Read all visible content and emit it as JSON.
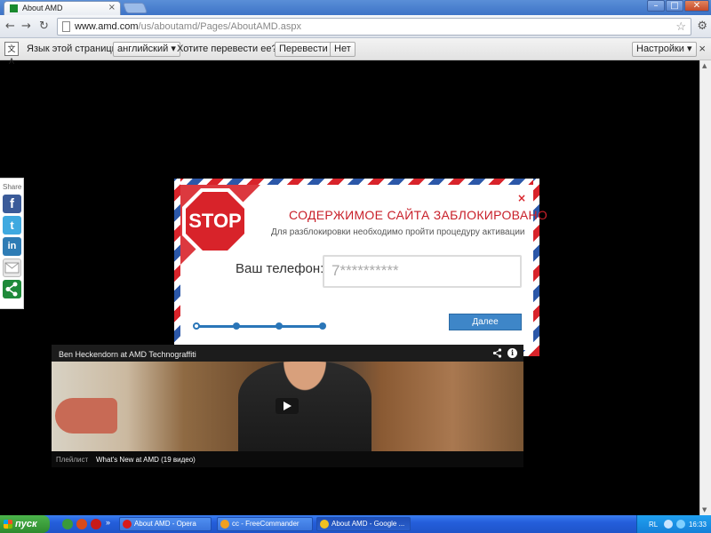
{
  "browser": {
    "tab_title": "About AMD",
    "tab_close": "×",
    "window_buttons": {
      "minimize": "–",
      "maximize": "□",
      "close": "✕"
    },
    "url_host": "www.amd.com",
    "url_path": "/us/aboutamd/Pages/AboutAMD.aspx",
    "nav": {
      "back": "←",
      "forward": "→",
      "reload": "↻"
    },
    "star": "☆",
    "wrench": "⚙"
  },
  "translate_bar": {
    "icon": "文A",
    "prompt": "Язык этой страницы:",
    "language": "английский ▾",
    "question": "Хотите перевести ее?",
    "translate_button": "Перевести",
    "no_button": "Нет",
    "settings_button": "Настройки ▾",
    "close": "×"
  },
  "share_panel": {
    "label": "Share",
    "facebook": "f",
    "twitter": "t",
    "linkedin": "in",
    "email": "",
    "share": "≪"
  },
  "popup": {
    "stop_sign": "STOP",
    "title": "СОДЕРЖИМОЕ САЙТА ЗАБЛОКИРОВАНО",
    "subtitle": "Для разблокировки необходимо пройти процедуру активации",
    "phone_label": "Ваш телефон:",
    "phone_value": "7**********",
    "next_button": "Далее",
    "close": "×",
    "progress": {
      "steps": 4,
      "current": 1
    }
  },
  "video": {
    "title": "Ben Heckendorn at AMD Technograffiti",
    "share_icon": "⋖",
    "info_icon": "i",
    "playlist_label": "Плейлист",
    "playlist_title": "What's New at AMD (19 видео)"
  },
  "taskbar": {
    "start": "пуск",
    "windows": [
      {
        "label": "About AMD - Opera",
        "color": "#d81b1b"
      },
      {
        "label": "cc - FreeCommander",
        "color": "#f0a020"
      },
      {
        "label": "About AMD - Google ...",
        "color": "#f0c020"
      }
    ],
    "language": "RL",
    "time": "16:33"
  },
  "colors": {
    "popup_red": "#c8202a",
    "popup_blue": "#2b57a8",
    "button_blue": "#3e86c8"
  }
}
